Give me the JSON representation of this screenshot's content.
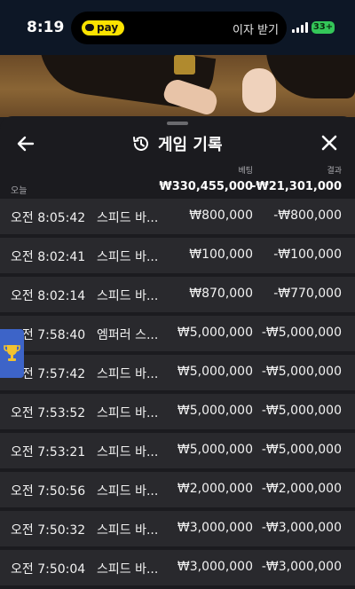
{
  "status_bar": {
    "time": "8:19",
    "pay_label": "pay",
    "island_text": "이자 받기",
    "battery": "33+"
  },
  "sheet": {
    "title": "게임 기록",
    "columns": {
      "bet": "베팅",
      "result": "결과"
    },
    "summary": {
      "label": "오늘",
      "total_bet": "₩330,455,000",
      "total_result": "-₩21,301,000"
    },
    "rows": [
      {
        "time": "오전 8:05:42",
        "game": "스피드 바...",
        "bet": "₩800,000",
        "result": "-₩800,000"
      },
      {
        "time": "오전 8:02:41",
        "game": "스피드 바...",
        "bet": "₩100,000",
        "result": "-₩100,000"
      },
      {
        "time": "오전 8:02:14",
        "game": "스피드 바...",
        "bet": "₩870,000",
        "result": "-₩770,000"
      },
      {
        "time": "오전 7:58:40",
        "game": "엠퍼러 스...",
        "bet": "₩5,000,000",
        "result": "-₩5,000,000"
      },
      {
        "time": "오전 7:57:42",
        "game": "스피드 바...",
        "bet": "₩5,000,000",
        "result": "-₩5,000,000"
      },
      {
        "time": "오전 7:53:52",
        "game": "스피드 바...",
        "bet": "₩5,000,000",
        "result": "-₩5,000,000"
      },
      {
        "time": "오전 7:53:21",
        "game": "스피드 바...",
        "bet": "₩5,000,000",
        "result": "-₩5,000,000"
      },
      {
        "time": "오전 7:50:56",
        "game": "스피드 바...",
        "bet": "₩2,000,000",
        "result": "-₩2,000,000"
      },
      {
        "time": "오전 7:50:32",
        "game": "스피드 바...",
        "bet": "₩3,000,000",
        "result": "-₩3,000,000"
      },
      {
        "time": "오전 7:50:04",
        "game": "스피드 바...",
        "bet": "₩3,000,000",
        "result": "-₩3,000,000"
      }
    ]
  },
  "icons": {
    "back": "arrow-left-icon",
    "history": "history-clock-icon",
    "close": "close-icon",
    "trophy": "trophy-icon"
  },
  "colors": {
    "sheet_bg": "#1b1b1f",
    "row_bg": "#29292d",
    "pay_yellow": "#fbe300",
    "battery_green": "#34c759",
    "trophy_tab": "#3d64c8"
  }
}
